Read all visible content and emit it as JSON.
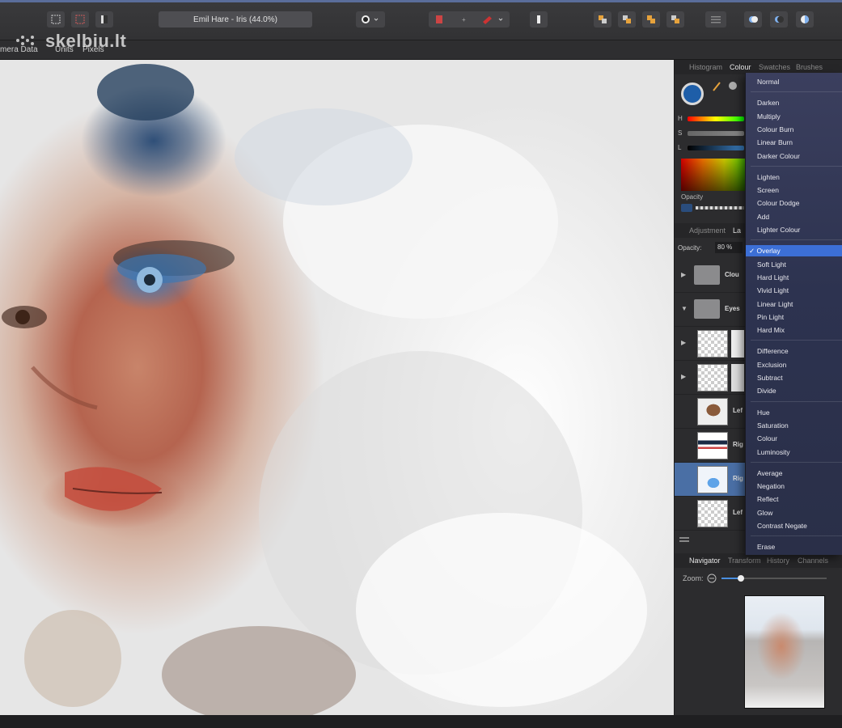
{
  "toolbar": {
    "document_title": "Emil Hare - Iris (44.0%)",
    "buttons": [
      "marquee-icon",
      "crop-icon",
      "export-icon",
      "circle-icon",
      "layer-icon",
      "brush-icon",
      "pencil-icon",
      "arrange-1-icon",
      "arrange-2-icon",
      "arrange-3-icon",
      "arrange-4-icon",
      "menu-icon",
      "boolean-add-icon",
      "boolean-subtract-icon",
      "boolean-intersect-icon"
    ]
  },
  "context_bar": {
    "camera": "mera Data",
    "units_label": "Units",
    "units_value": "Pixels"
  },
  "watermark": "skelbiu.lt",
  "panel": {
    "tabs": [
      "Histogram",
      "Colour",
      "Swatches",
      "Brushes"
    ],
    "active_tab": "Colour",
    "sliders": {
      "h": "H",
      "s": "S",
      "l": "L"
    },
    "opacity_label": "Opacity",
    "adjustment_tabs": [
      "Adjustment",
      "La"
    ],
    "layer_opacity_label": "Opacity:",
    "layer_opacity_value": "80 %",
    "layers": [
      {
        "name": "Clou",
        "type": "folder",
        "expanded": false
      },
      {
        "name": "Eyes",
        "type": "folder",
        "expanded": true
      },
      {
        "name": "",
        "type": "layer"
      },
      {
        "name": "",
        "type": "layer"
      },
      {
        "name": "Lef",
        "type": "layer"
      },
      {
        "name": "Rig",
        "type": "layer"
      },
      {
        "name": "Rig",
        "type": "layer",
        "selected": true
      },
      {
        "name": "Lef",
        "type": "layer"
      }
    ]
  },
  "blend_menu": {
    "groups": [
      [
        "Normal"
      ],
      [
        "Darken",
        "Multiply",
        "Colour Burn",
        "Linear Burn",
        "Darker Colour"
      ],
      [
        "Lighten",
        "Screen",
        "Colour Dodge",
        "Add",
        "Lighter Colour"
      ],
      [
        "Overlay",
        "Soft Light",
        "Hard Light",
        "Vivid Light",
        "Linear Light",
        "Pin Light",
        "Hard Mix"
      ],
      [
        "Difference",
        "Exclusion",
        "Subtract",
        "Divide"
      ],
      [
        "Hue",
        "Saturation",
        "Colour",
        "Luminosity"
      ],
      [
        "Average",
        "Negation",
        "Reflect",
        "Glow",
        "Contrast Negate"
      ],
      [
        "Erase"
      ]
    ],
    "checked": "Overlay"
  },
  "navigator": {
    "tabs": [
      "Navigator",
      "Transform",
      "History",
      "Channels"
    ],
    "active_tab": "Navigator",
    "zoom_label": "Zoom:"
  },
  "colors": {
    "accent": "#3c6fd6",
    "selected_layer": "#4a6fa5",
    "colour_swatch": "#1e5ea8"
  }
}
